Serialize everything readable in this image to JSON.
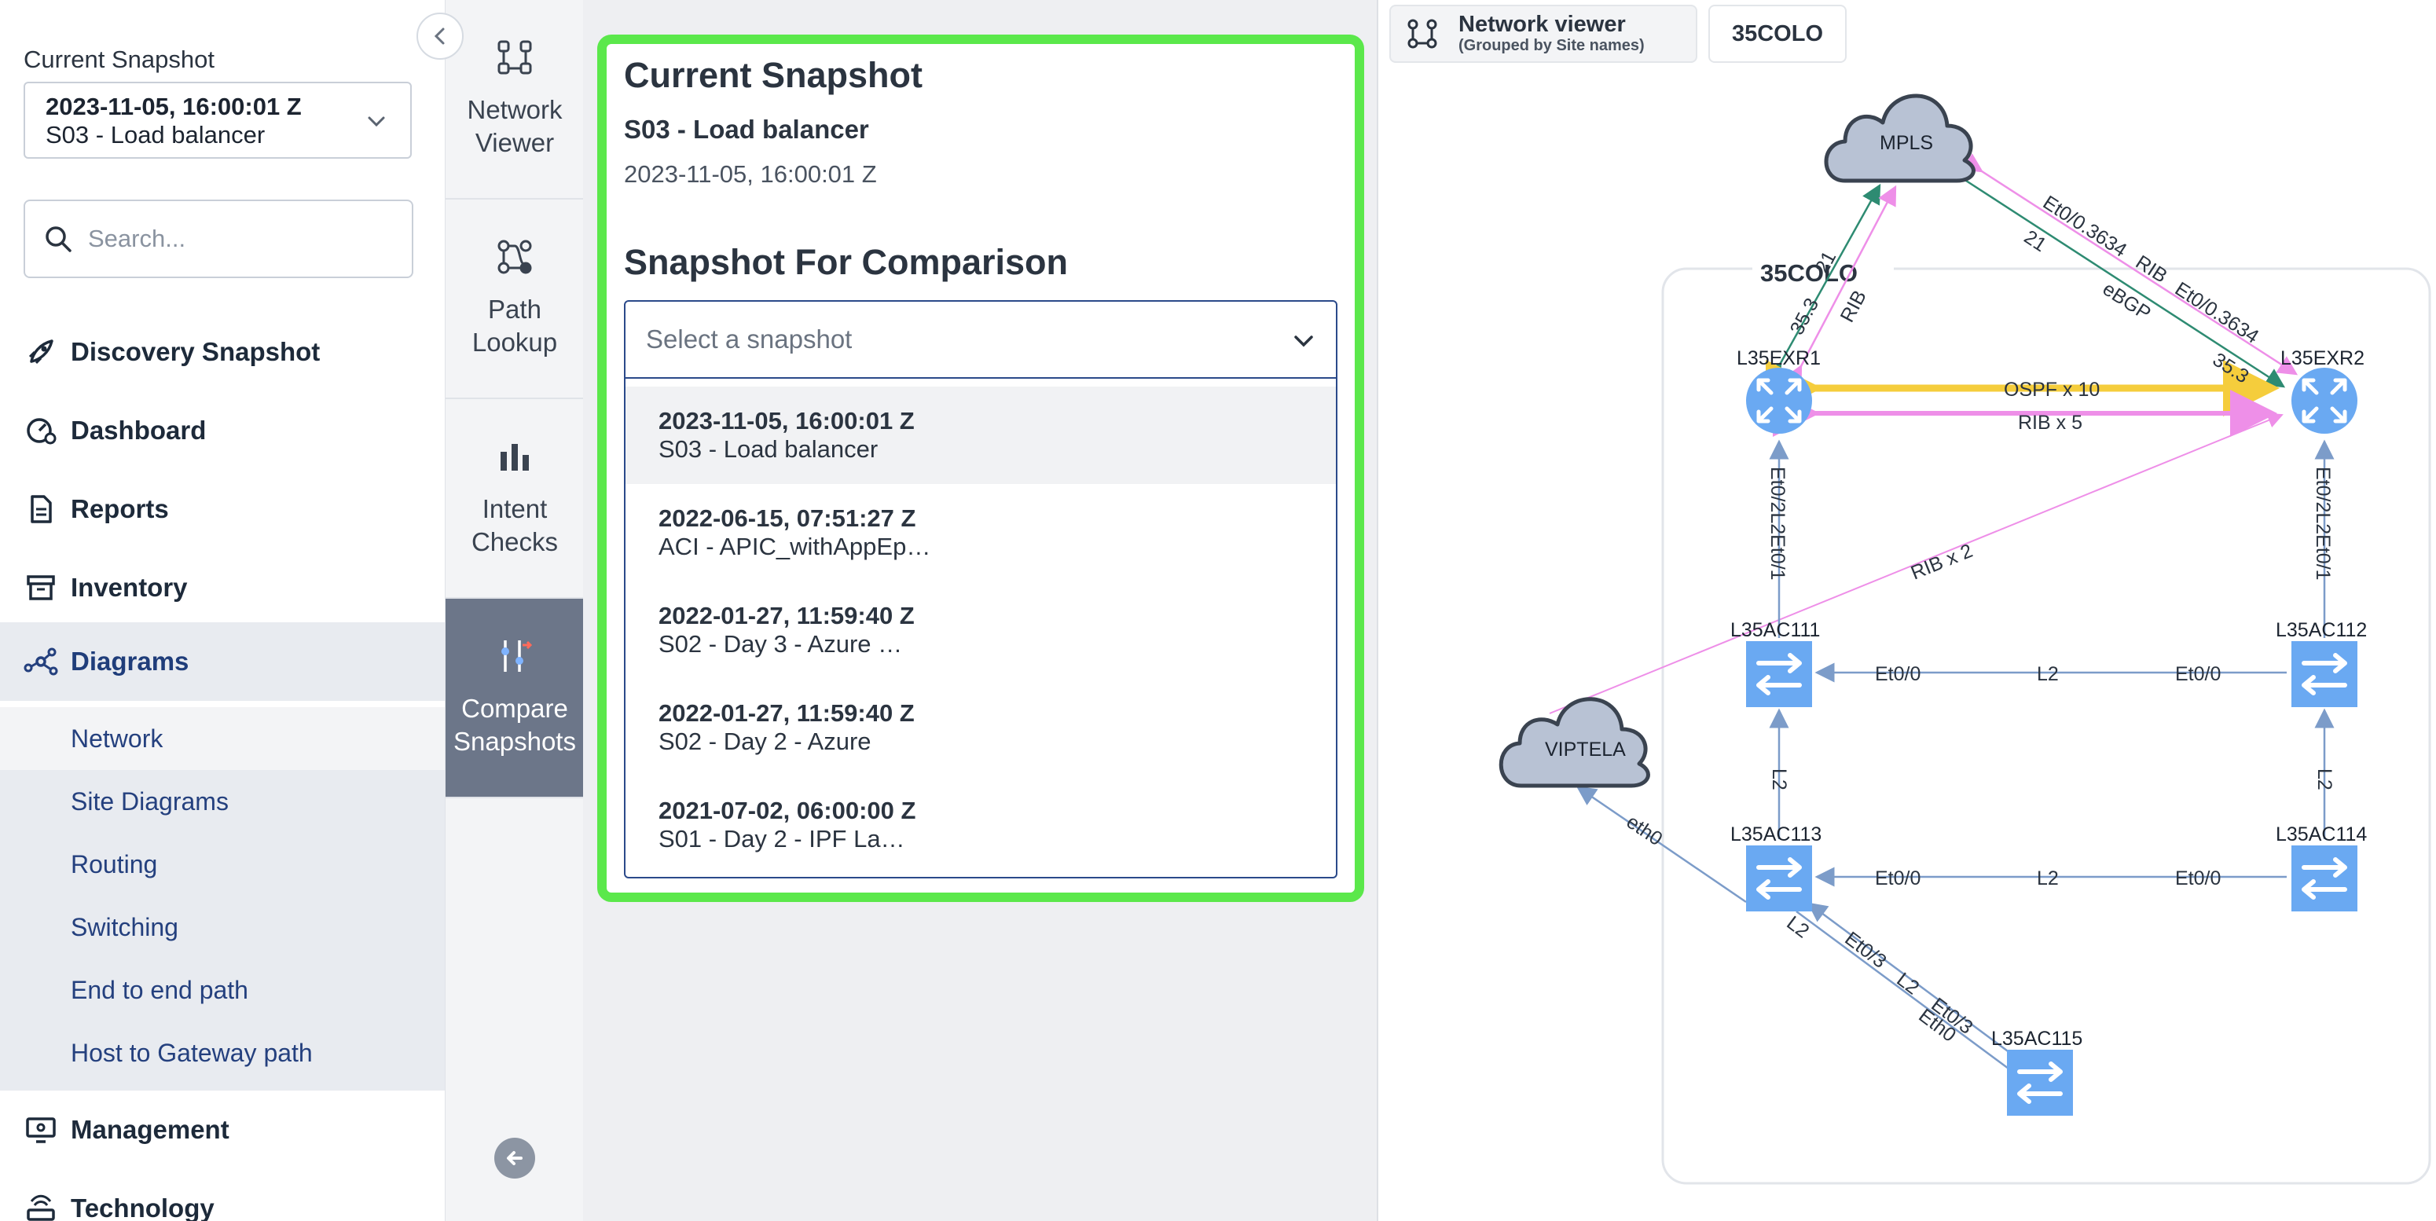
{
  "sidebar": {
    "collapse_icon": "chevron-left-icon",
    "current_snapshot_label": "Current Snapshot",
    "current_snapshot_date": "2023-11-05, 16:00:01 Z",
    "current_snapshot_name": "S03 - Load balancer",
    "search_placeholder": "Search...",
    "items": [
      {
        "label": "Discovery Snapshot",
        "icon": "rocket-icon"
      },
      {
        "label": "Dashboard",
        "icon": "dashboard-gauge-icon"
      },
      {
        "label": "Reports",
        "icon": "document-icon"
      },
      {
        "label": "Inventory",
        "icon": "archive-box-icon"
      },
      {
        "label": "Diagrams",
        "icon": "network-nodes-icon"
      },
      {
        "label": "Management",
        "icon": "monitor-settings-icon"
      },
      {
        "label": "Technology",
        "icon": "router-icon"
      }
    ],
    "subitems": [
      "Network",
      "Site Diagrams",
      "Routing",
      "Switching",
      "End to end path",
      "Host to Gateway path"
    ]
  },
  "rail": {
    "items": [
      {
        "label_1": "Network",
        "label_2": "Viewer",
        "icon": "topology-icon"
      },
      {
        "label_1": "Path",
        "label_2": "Lookup",
        "icon": "path-icon"
      },
      {
        "label_1": "Intent",
        "label_2": "Checks",
        "icon": "bar-chart-icon"
      },
      {
        "label_1": "Compare",
        "label_2": "Snapshots",
        "icon": "compare-icon"
      }
    ],
    "back_icon": "arrow-left-circle-icon"
  },
  "compare": {
    "current_heading": "Current Snapshot",
    "current_name": "S03 - Load balancer",
    "current_date": "2023-11-05, 16:00:01 Z",
    "comparison_heading": "Snapshot For Comparison",
    "select_placeholder": "Select a snapshot",
    "options": [
      {
        "date": "2023-11-05, 16:00:01 Z",
        "name": "S03 - Load balancer"
      },
      {
        "date": "2022-06-15, 07:51:27 Z",
        "name": "ACI - APIC_withAppEp…"
      },
      {
        "date": "2022-01-27, 11:59:40 Z",
        "name": "S02 - Day 3 - Azure …"
      },
      {
        "date": "2022-01-27, 11:59:40 Z",
        "name": "S02 - Day 2 - Azure"
      },
      {
        "date": "2021-07-02, 06:00:00 Z",
        "name": "S01 - Day 2 - IPF La…"
      }
    ]
  },
  "viewer": {
    "tab_title": "Network viewer",
    "tab_subtitle": "(Grouped by Site names)",
    "site_tab": "35COLO",
    "site_group_label": "35COLO",
    "clouds": {
      "mpls": "MPLS",
      "viptela": "VIPTELA"
    },
    "routers": {
      "r1": "L35EXR1",
      "r2": "L35EXR2"
    },
    "switches": {
      "s111": "L35AC111",
      "s112": "L35AC112",
      "s113": "L35AC113",
      "s114": "L35AC114",
      "s115": "L35AC115"
    },
    "edge_labels": {
      "ospf": "OSPF x 10",
      "rib5": "RIB x 5",
      "rib2": "RIB x 2",
      "r1_mpls_num": "21",
      "r1_mpls_rib": "RIB",
      "r1_mpls_353": "35.3",
      "r2_mpls_21": "21",
      "r2_mpls_ebgp": "eBGP",
      "r2_mpls_353": "35.3",
      "r2_mpls_et1": "Et0/0.3634",
      "r2_mpls_rib": "RIB",
      "r2_mpls_et2": "Et0/0.3634",
      "r1_s111": "Et0/2L2Et0/1",
      "r2_s112": "Et0/2L2Et0/1",
      "s111_s112_a": "Et0/0",
      "s111_s112_l2": "L2",
      "s111_s112_b": "Et0/0",
      "s113_s114_a": "Et0/0",
      "s113_s114_l2": "L2",
      "s113_s114_b": "Et0/0",
      "s111_s113": "L2",
      "s112_s114": "L2",
      "viptela_s113": "eth0",
      "s113_s115_l2": "L2",
      "s113_s115_et": "Et0/3",
      "s113_s115_l2b": "L2",
      "s113_s115_et3": "Et0/3",
      "s113_s115_eth": "Eth0"
    },
    "colors": {
      "ospf": "#f5cd3c",
      "rib": "#ee8fe8",
      "ebgp": "#2e8b72",
      "link": "#7c9cc9",
      "device": "#6aa9f2",
      "cloud": "#b8c2d4"
    }
  }
}
